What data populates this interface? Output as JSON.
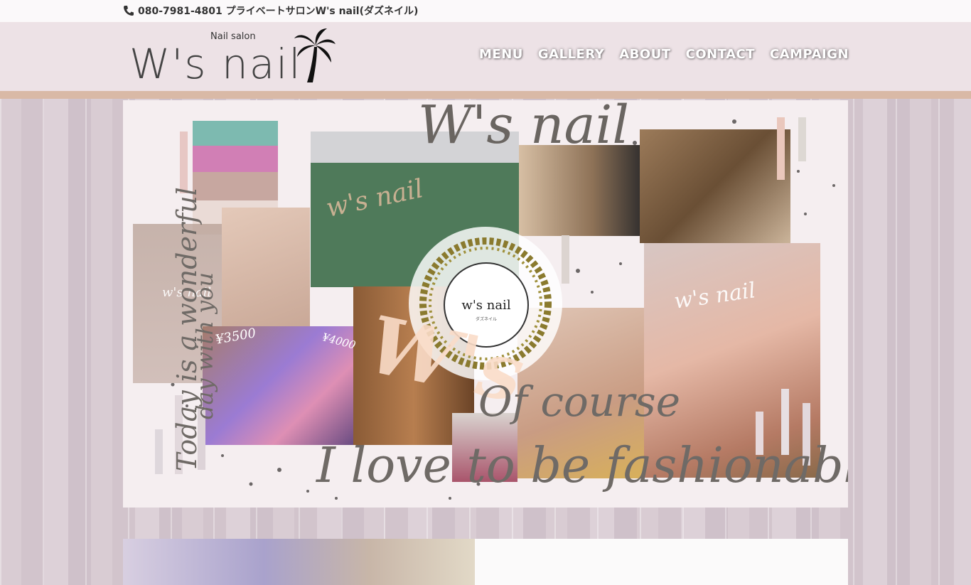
{
  "topbar": {
    "phone": "080-7981-4801 プライベートサロンW's nail(ダズネイル)"
  },
  "logo": {
    "subtitle": "Nail salon",
    "name": "W's nail"
  },
  "nav": [
    "MENU",
    "GALLERY",
    "ABOUT",
    "CONTACT",
    "CAMPAIGN"
  ],
  "hero": {
    "title_script": "W's nail",
    "left_script_1": "Today is a wonderful",
    "left_script_2": "day with you",
    "ws_label": "W's",
    "watermark_1": "w's nail",
    "watermark_2": "w's nail",
    "watermark_3": "w's nail",
    "price_1": "¥3500",
    "price_2": "¥4000",
    "badge_name": "w's nail",
    "badge_sub": "ダズネイル",
    "of_course": "Of course",
    "fashionable": "I love to be fashionable"
  },
  "colors": {
    "header_bg": "#ede2e6",
    "stripe": "#d9b9a6",
    "hero_bg": "#f5eef0"
  }
}
